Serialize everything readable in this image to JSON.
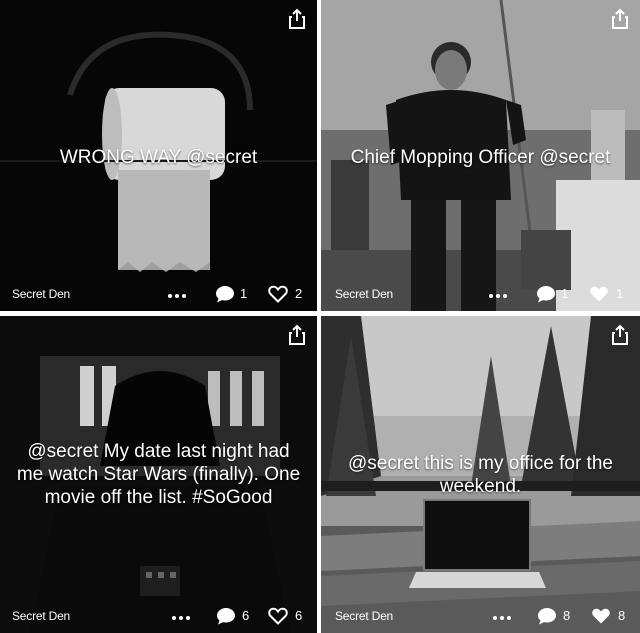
{
  "posts": [
    {
      "caption": "WRONG WAY @secret",
      "author": "Secret Den",
      "comments": "1",
      "likes": "2"
    },
    {
      "caption": "Chief Mopping Officer @secret",
      "author": "Secret Den",
      "comments": "1",
      "likes": "1"
    },
    {
      "caption": "@secret My date last night had me watch Star Wars (finally). One movie off the list. #SoGood",
      "author": "Secret Den",
      "comments": "6",
      "likes": "6"
    },
    {
      "caption": "@secret this is my office for the weekend.",
      "author": "Secret Den",
      "comments": "8",
      "likes": "8"
    }
  ],
  "icons": {
    "share": "share-icon",
    "more": "more-dots-icon",
    "comment": "comment-bubble-icon",
    "like": "heart-icon"
  },
  "colors": {
    "text": "#ffffff",
    "divider": "#ffffff"
  }
}
